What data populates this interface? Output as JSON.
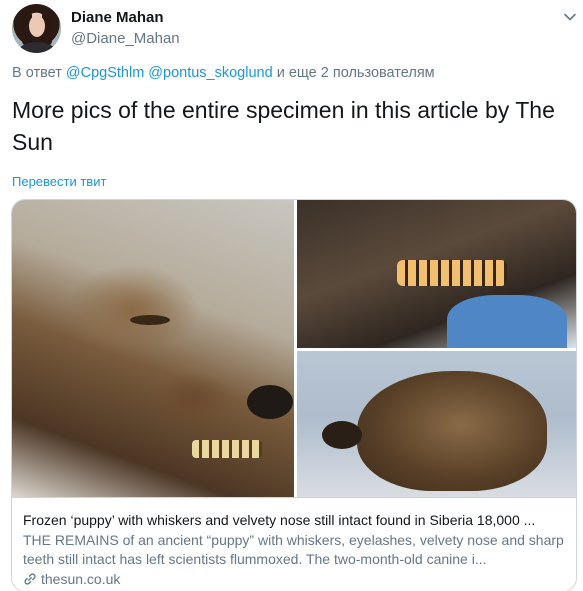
{
  "tweet": {
    "author": {
      "name": "Diane Mahan",
      "handle": "@Diane_Mahan"
    },
    "reply": {
      "prefix": "В ответ ",
      "mentions": "@CpgSthlm @pontus_skoglund",
      "suffix": " и еще 2 пользователям"
    },
    "text": "More pics of the entire specimen in this article by The Sun",
    "translate_label": "Перевести твит",
    "card": {
      "title": "Frozen ‘puppy’ with whiskers and velvety nose still intact found in Siberia 18,000 ...",
      "description": "THE REMAINS of an ancient “puppy” with whiskers, eyelashes, velvety nose and sharp teeth still intact has left scientists flummoxed. The two-month-old canine i...",
      "domain": "thesun.co.uk"
    }
  },
  "icons": {
    "menu": "chevron-down-icon",
    "link": "link-icon"
  },
  "colors": {
    "link": "#1b95e0",
    "secondary": "#657786",
    "primary": "#14171a",
    "border": "#ccd6dd"
  }
}
